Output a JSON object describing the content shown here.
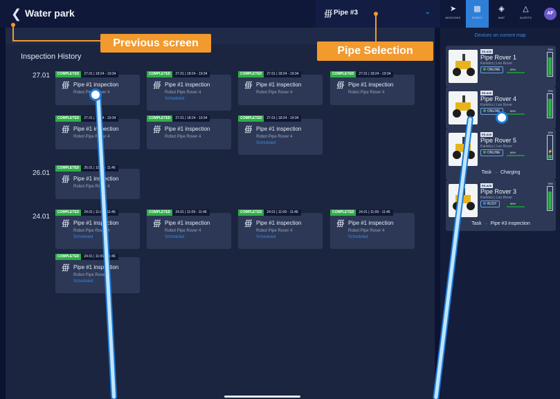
{
  "header": {
    "back_icon": "chevron-left-icon",
    "title": "Water park"
  },
  "pipe_selector": {
    "icon": "pipe-icon",
    "label": "Pipe #3"
  },
  "annotations": {
    "previous_screen": "Previous screen",
    "pipe_selection": "Pipe Selection"
  },
  "nav": {
    "tabs": [
      {
        "label": "MISSIONS",
        "icon": "rocket-icon"
      },
      {
        "label": "ROBOT",
        "icon": "robot-icon"
      },
      {
        "label": "MAP",
        "icon": "layers-icon"
      },
      {
        "label": "ALERTS",
        "icon": "bell-icon"
      }
    ],
    "avatar": "AF"
  },
  "inspection": {
    "title": "Inspection History",
    "status_label": "COMPLETED",
    "task_name": "Pipe #1 inspection",
    "robot_text": "Robot Pipe Rover 4",
    "scheduled_text": "Scheduled",
    "dates": [
      "27.01",
      "26.01",
      "24.01"
    ],
    "cards": [
      {
        "time": "27.01  |  18:24 - 19:34",
        "scheduled": false
      },
      {
        "time": "27.01  |  18:24 - 19:34",
        "scheduled": true
      },
      {
        "time": "27.01  |  18:24 - 19:34",
        "scheduled": false
      },
      {
        "time": "27.01  |  18:24 - 19:34",
        "scheduled": false
      },
      {
        "time": "27.01  |  18:24 - 19:34",
        "scheduled": false
      },
      {
        "time": "27.01  |  18:24 - 19:34",
        "scheduled": false
      },
      {
        "time": "27.01  |  18:24 - 19:34",
        "scheduled": true
      },
      {
        "time": "26.01  |  11:09 - 11:46",
        "scheduled": false
      },
      {
        "time": "24.01  |  11:09 - 11:46",
        "scheduled": true
      },
      {
        "time": "24.01  |  11:09 - 11:46",
        "scheduled": true
      },
      {
        "time": "24.01  |  11:09 - 11:46",
        "scheduled": true
      },
      {
        "time": "24.01  |  11:09 - 11:46",
        "scheduled": true
      },
      {
        "time": "24.01  |  11:09 - 11:46",
        "scheduled": true
      }
    ]
  },
  "devices": {
    "title": "Devices on current map",
    "task_label": "Task",
    "items": [
      {
        "code": "ES-A28",
        "name": "Pipe Rover 1",
        "sub": "Karlstics | Leo Rover",
        "status": "ONLINE",
        "battery": "89%",
        "percent": "76%",
        "level": 0.76,
        "charging": false,
        "task": ""
      },
      {
        "code": "ES-A28",
        "name": "Pipe Rover 4",
        "sub": "Karlstics | Leo Rover",
        "status": "ONLINE",
        "battery": "89%",
        "percent": "76%",
        "level": 0.76,
        "charging": false,
        "task": ""
      },
      {
        "code": "ES-A28",
        "name": "Pipe Rover 5",
        "sub": "Karlstics | Leo Rover",
        "status": "ONLINE",
        "battery": "89%",
        "percent": "16%",
        "level": 0.16,
        "charging": true,
        "task": "Charging"
      },
      {
        "code": "ES-A28",
        "name": "Pipe Rover 3",
        "sub": "Karlstics | Leo Rover",
        "status": "BUSY",
        "battery": "89%",
        "percent": "76%",
        "level": 0.76,
        "charging": false,
        "task": "Pipe #3 inspection"
      }
    ]
  },
  "colors": {
    "accent": "#2f7fd8",
    "completed": "#2db045",
    "annotation": "#f29a2e",
    "background": "#0b1330"
  }
}
